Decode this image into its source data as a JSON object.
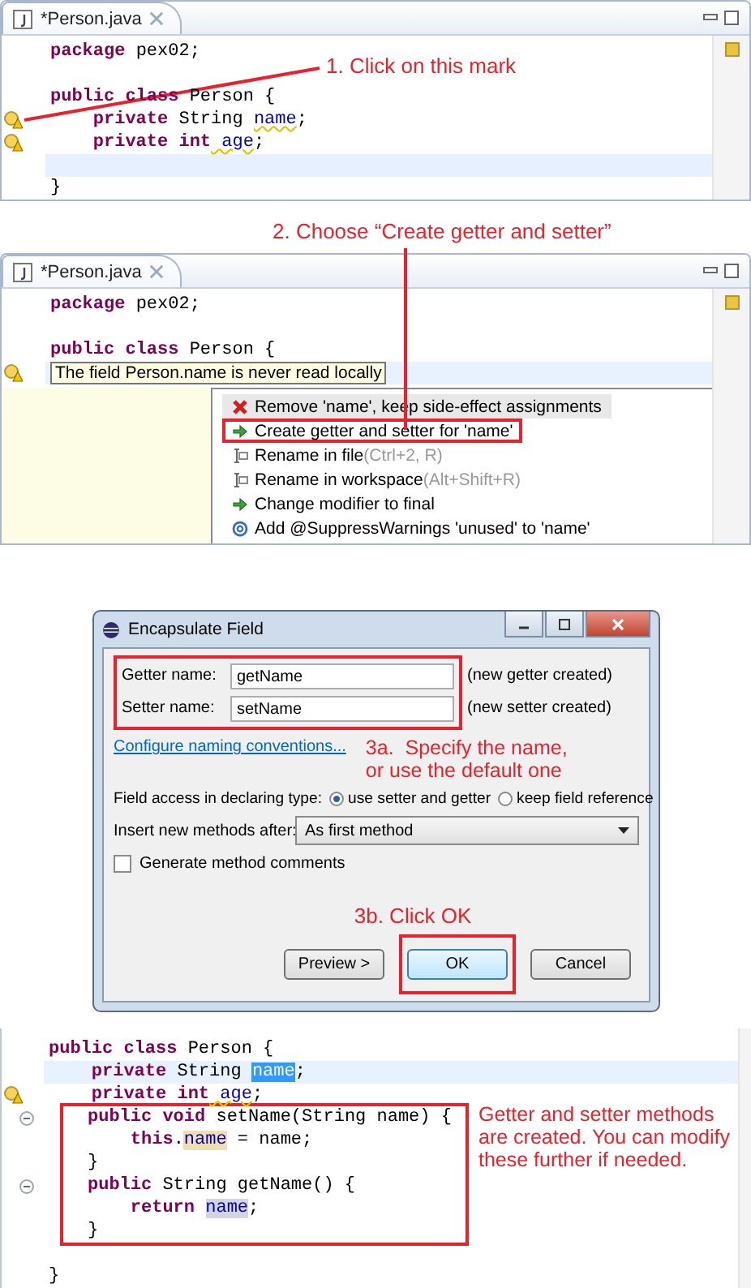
{
  "step1": {
    "annotation": "1. Click on this mark",
    "tab": {
      "title": "*Person.java"
    },
    "lines": [
      {
        "kind": "code",
        "tokens": [
          {
            "text": "package",
            "kind": "keyword"
          },
          {
            "text": " pex02;",
            "kind": "plain"
          }
        ]
      },
      {
        "kind": "blank"
      },
      {
        "kind": "code",
        "tokens": [
          {
            "text": "public class",
            "kind": "keyword"
          },
          {
            "text": " Person {",
            "kind": "plain"
          }
        ]
      },
      {
        "kind": "code",
        "warning": true,
        "tokens": [
          {
            "text": "    private",
            "kind": "keyword"
          },
          {
            "text": " String ",
            "kind": "plain"
          },
          {
            "text": "name",
            "kind": "field-warn"
          },
          {
            "text": ";",
            "kind": "plain"
          }
        ]
      },
      {
        "kind": "code",
        "warning": true,
        "tokens": [
          {
            "text": "    private int",
            "kind": "keyword"
          },
          {
            "text": " age",
            "kind": "field-warn"
          },
          {
            "text": ";",
            "kind": "plain"
          }
        ]
      },
      {
        "kind": "blank",
        "current": true
      },
      {
        "kind": "code",
        "tokens": [
          {
            "text": "}",
            "kind": "plain"
          }
        ]
      }
    ]
  },
  "step2": {
    "annotation": "2. Choose “Create getter and setter”",
    "tab": {
      "title": "*Person.java"
    },
    "lines": [
      {
        "kind": "code",
        "tokens": [
          {
            "text": "package",
            "kind": "keyword"
          },
          {
            "text": " pex02;",
            "kind": "plain"
          }
        ]
      },
      {
        "kind": "blank"
      },
      {
        "kind": "code",
        "tokens": [
          {
            "text": "public class",
            "kind": "keyword"
          },
          {
            "text": " Person {",
            "kind": "plain"
          }
        ]
      },
      {
        "kind": "code",
        "warning": true,
        "current": true,
        "tooltip": "The field Person.name is never read locally"
      }
    ],
    "quick_fixes": [
      {
        "kind": "remove",
        "label": "Remove 'name', keep side-effect assignments",
        "selected": true,
        "highlighted": false
      },
      {
        "kind": "change",
        "label": "Create getter and setter for 'name'",
        "selected": false,
        "highlighted": true
      },
      {
        "kind": "rename",
        "label": "Rename in file",
        "shortcut": "(Ctrl+2, R)",
        "selected": false,
        "highlighted": false
      },
      {
        "kind": "rename",
        "label": "Rename in workspace",
        "shortcut": "(Alt+Shift+R)",
        "selected": false,
        "highlighted": false
      },
      {
        "kind": "change",
        "label": "Change modifier to final",
        "selected": false,
        "highlighted": false
      },
      {
        "kind": "annotation",
        "label": "Add @SuppressWarnings 'unused' to 'name'",
        "selected": false,
        "highlighted": false
      }
    ]
  },
  "dialog": {
    "title": "Encapsulate Field",
    "fields": [
      {
        "label": "Getter name:",
        "value": "getName",
        "note": "(new getter created)"
      },
      {
        "label": "Setter name:",
        "value": "setName",
        "note": "(new setter created)"
      }
    ],
    "link": "Configure naming conventions...",
    "annotation_a": "3a.  Specify the name,\nor use the default one",
    "access_label": "Field access in declaring type:",
    "access_options": [
      {
        "label": "use setter and getter",
        "selected": true
      },
      {
        "label": "keep field reference",
        "selected": false
      }
    ],
    "insert_label": "Insert new methods after:",
    "insert_value": "As first method",
    "comments": {
      "label": "Generate method comments",
      "checked": false
    },
    "annotation_b": "3b.  Click OK",
    "buttons": [
      {
        "label": "Preview >",
        "default": false,
        "highlighted": false
      },
      {
        "label": "OK",
        "default": true,
        "highlighted": true
      },
      {
        "label": "Cancel",
        "default": false,
        "highlighted": false
      }
    ]
  },
  "step4": {
    "groups": [
      {
        "boxed": false,
        "lines": [
          {
            "tokens": [
              {
                "text": "public class",
                "kind": "keyword"
              },
              {
                "text": " Person {",
                "kind": "plain"
              }
            ]
          },
          {
            "current": true,
            "tokens": [
              {
                "text": "    private",
                "kind": "keyword"
              },
              {
                "text": " String ",
                "kind": "plain"
              },
              {
                "text": "name",
                "kind": "selected"
              },
              {
                "text": ";",
                "kind": "plain"
              }
            ]
          },
          {
            "warning": true,
            "tokens": [
              {
                "text": "    private int",
                "kind": "keyword"
              },
              {
                "text": " age",
                "kind": "field-warn"
              },
              {
                "text": ";",
                "kind": "plain"
              }
            ]
          }
        ]
      },
      {
        "boxed": true,
        "note": "Getter and setter methods are created.  You can modify these further if needed.",
        "lines": [
          {
            "fold": true,
            "tokens": [
              {
                "text": "public void",
                "kind": "keyword"
              },
              {
                "text": " setName(String name) {",
                "kind": "plain"
              }
            ]
          },
          {
            "tokens": [
              {
                "text": "    this",
                "kind": "keyword"
              },
              {
                "text": ".",
                "kind": "plain"
              },
              {
                "text": "name",
                "kind": "write-occurrence"
              },
              {
                "text": " = name;",
                "kind": "plain"
              }
            ]
          },
          {
            "tokens": [
              {
                "text": "}",
                "kind": "plain"
              }
            ]
          },
          {
            "fold": true,
            "tokens": [
              {
                "text": "public",
                "kind": "keyword"
              },
              {
                "text": " String getName() {",
                "kind": "plain"
              }
            ]
          },
          {
            "tokens": [
              {
                "text": "    return ",
                "kind": "keyword"
              },
              {
                "text": "name",
                "kind": "read-occurrence"
              },
              {
                "text": ";",
                "kind": "plain"
              }
            ]
          },
          {
            "tokens": [
              {
                "text": "}",
                "kind": "plain"
              }
            ]
          }
        ]
      },
      {
        "boxed": false,
        "lines": [
          {
            "tokens": [
              {
                "text": "}",
                "kind": "plain"
              }
            ]
          }
        ]
      }
    ]
  }
}
